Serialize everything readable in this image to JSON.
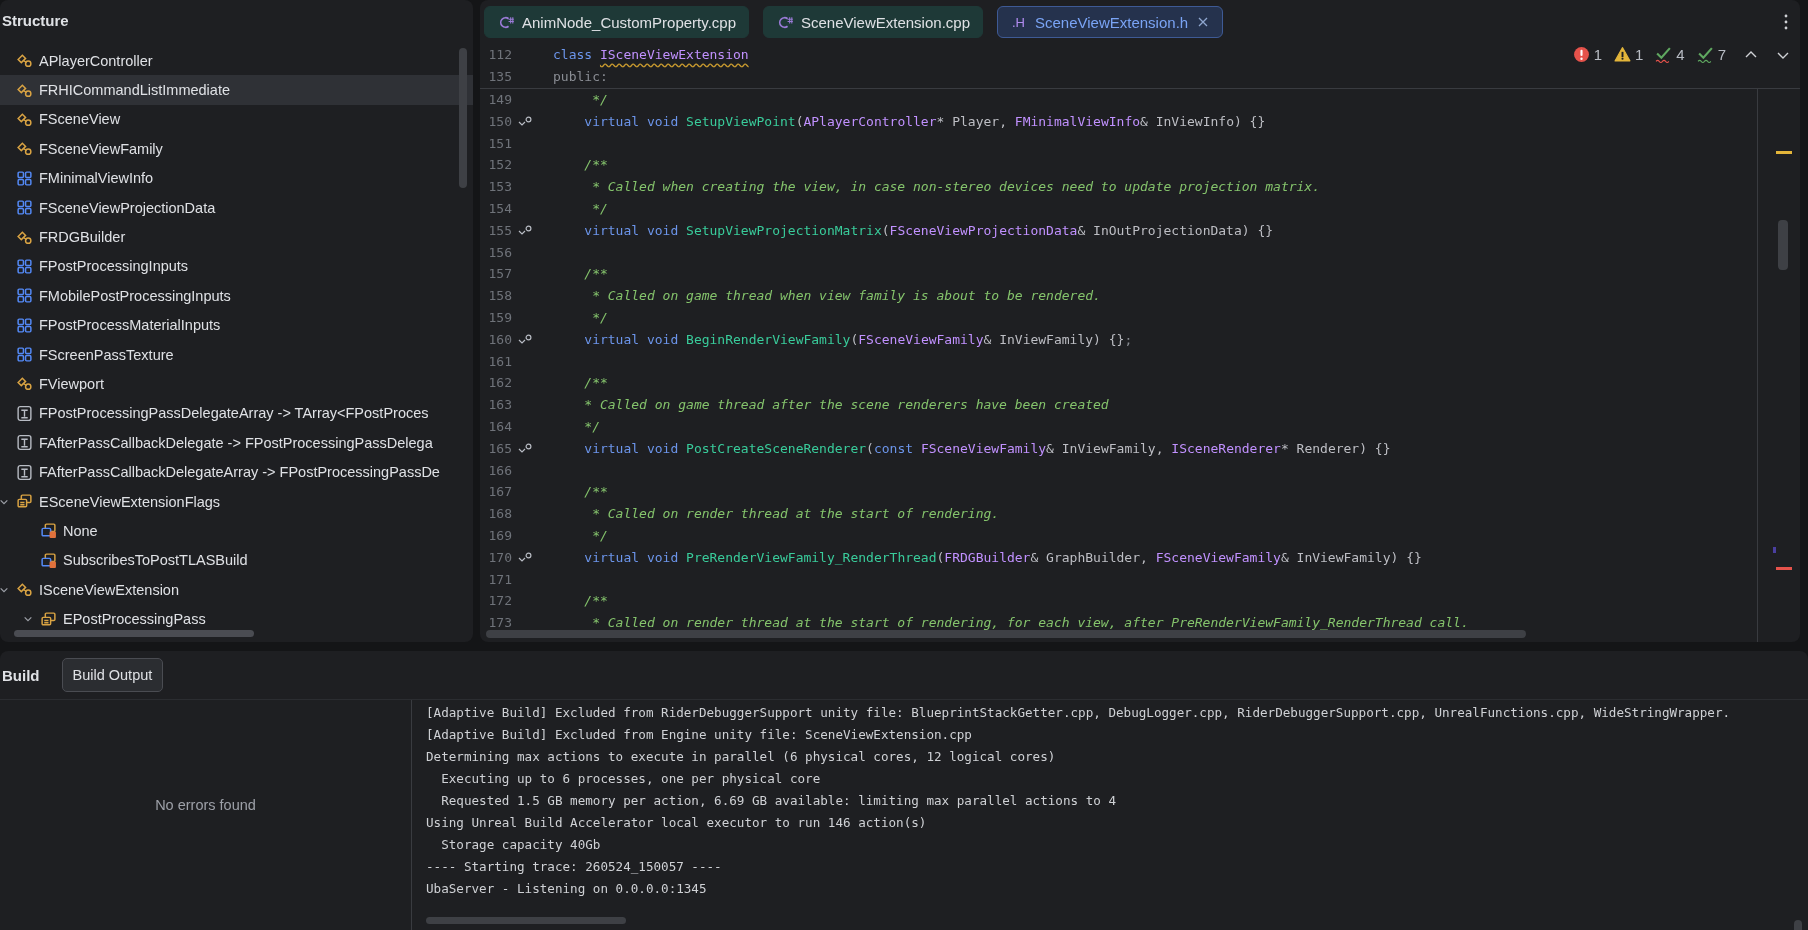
{
  "structure": {
    "title": "Structure",
    "items": [
      {
        "label": "APlayerController",
        "kind": "class",
        "selected": false
      },
      {
        "label": "FRHICommandListImmediate",
        "kind": "class",
        "selected": true
      },
      {
        "label": "FSceneView",
        "kind": "class",
        "selected": false
      },
      {
        "label": "FSceneViewFamily",
        "kind": "class",
        "selected": false
      },
      {
        "label": "FMinimalViewInfo",
        "kind": "struct",
        "selected": false
      },
      {
        "label": "FSceneViewProjectionData",
        "kind": "struct",
        "selected": false
      },
      {
        "label": "FRDGBuilder",
        "kind": "class",
        "selected": false
      },
      {
        "label": "FPostProcessingInputs",
        "kind": "struct",
        "selected": false
      },
      {
        "label": "FMobilePostProcessingInputs",
        "kind": "struct",
        "selected": false
      },
      {
        "label": "FPostProcessMaterialInputs",
        "kind": "struct",
        "selected": false
      },
      {
        "label": "FScreenPassTexture",
        "kind": "struct",
        "selected": false
      },
      {
        "label": "FViewport",
        "kind": "class",
        "selected": false
      },
      {
        "label": "FPostProcessingPassDelegateArray -> TArray<FPostProces",
        "kind": "typedef",
        "selected": false
      },
      {
        "label": "FAfterPassCallbackDelegate -> FPostProcessingPassDelega",
        "kind": "typedef",
        "selected": false
      },
      {
        "label": "FAfterPassCallbackDelegateArray -> FPostProcessingPassDe",
        "kind": "typedef",
        "selected": false
      },
      {
        "label": "ESceneViewExtensionFlags",
        "kind": "enum",
        "selected": false,
        "expanded": true,
        "children": [
          {
            "label": "None",
            "kind": "enum_member",
            "selected": false
          },
          {
            "label": "SubscribesToPostTLASBuild",
            "kind": "enum_member",
            "selected": false
          }
        ]
      },
      {
        "label": "ISceneViewExtension",
        "kind": "class",
        "selected": false,
        "expanded": true,
        "children": [
          {
            "label": "EPostProcessingPass",
            "kind": "enum",
            "selected": false,
            "expanded": true
          }
        ]
      }
    ]
  },
  "editor": {
    "tabs": [
      {
        "label": "AnimNode_CustomProperty.cpp",
        "kind": "cpp",
        "selected": false
      },
      {
        "label": "SceneViewExtension.cpp",
        "kind": "cpp",
        "selected": false
      },
      {
        "label": "SceneViewExtension.h",
        "kind": "h",
        "badge": ".H",
        "selected": true
      }
    ],
    "inspections": [
      {
        "kind": "error",
        "count": "1"
      },
      {
        "kind": "warning",
        "count": "1"
      },
      {
        "kind": "weak",
        "count": "4"
      },
      {
        "kind": "typo",
        "count": "7"
      }
    ],
    "sticky_lines": [
      {
        "number": "112",
        "tokens": [
          {
            "text": "class ",
            "kind": "kw"
          },
          {
            "text": "ISceneViewExtension",
            "kind": "type_warn"
          }
        ]
      },
      {
        "number": "135",
        "tokens": [
          {
            "text": "public:",
            "kind": "dim"
          }
        ]
      }
    ],
    "lines": [
      {
        "number": "149",
        "marker": false,
        "tokens": [
          {
            "text": "     */",
            "kind": "comment"
          }
        ]
      },
      {
        "number": "150",
        "marker": true,
        "tokens": [
          {
            "text": "    virtual void ",
            "kind": "kw"
          },
          {
            "text": "SetupViewPoint",
            "kind": "fn"
          },
          {
            "text": "(",
            "kind": "plain"
          },
          {
            "text": "APlayerController",
            "kind": "type"
          },
          {
            "text": "* Player, ",
            "kind": "plain"
          },
          {
            "text": "FMinimalViewInfo",
            "kind": "type"
          },
          {
            "text": "& InViewInfo) {}",
            "kind": "plain"
          }
        ]
      },
      {
        "number": "151",
        "marker": false
      },
      {
        "number": "152",
        "marker": false,
        "tokens": [
          {
            "text": "    /**",
            "kind": "comment"
          }
        ]
      },
      {
        "number": "153",
        "marker": false,
        "tokens": [
          {
            "text": "     * Called when creating the view, in case non-stereo devices need to update projection matrix.",
            "kind": "comment"
          }
        ]
      },
      {
        "number": "154",
        "marker": false,
        "tokens": [
          {
            "text": "     */",
            "kind": "comment"
          }
        ]
      },
      {
        "number": "155",
        "marker": true,
        "tokens": [
          {
            "text": "    virtual void ",
            "kind": "kw"
          },
          {
            "text": "SetupViewProjectionMatrix",
            "kind": "fn"
          },
          {
            "text": "(",
            "kind": "plain"
          },
          {
            "text": "FSceneViewProjectionData",
            "kind": "type"
          },
          {
            "text": "& InOutProjectionData) {}",
            "kind": "plain"
          }
        ]
      },
      {
        "number": "156",
        "marker": false
      },
      {
        "number": "157",
        "marker": false,
        "tokens": [
          {
            "text": "    /**",
            "kind": "comment"
          }
        ]
      },
      {
        "number": "158",
        "marker": false,
        "tokens": [
          {
            "text": "     * Called on game thread when view family is about to be rendered.",
            "kind": "comment"
          }
        ]
      },
      {
        "number": "159",
        "marker": false,
        "tokens": [
          {
            "text": "     */",
            "kind": "comment"
          }
        ]
      },
      {
        "number": "160",
        "marker": true,
        "tokens": [
          {
            "text": "    virtual void ",
            "kind": "kw"
          },
          {
            "text": "BeginRenderViewFamily",
            "kind": "fn"
          },
          {
            "text": "(",
            "kind": "plain"
          },
          {
            "text": "FSceneViewFamily",
            "kind": "type"
          },
          {
            "text": "& InViewFamily) {}",
            "kind": "plain"
          },
          {
            "text": ";",
            "kind": "dim"
          }
        ]
      },
      {
        "number": "161",
        "marker": false
      },
      {
        "number": "162",
        "marker": false,
        "tokens": [
          {
            "text": "    /**",
            "kind": "comment"
          }
        ]
      },
      {
        "number": "163",
        "marker": false,
        "tokens": [
          {
            "text": "    * Called on game thread after the scene renderers have been created",
            "kind": "comment"
          }
        ]
      },
      {
        "number": "164",
        "marker": false,
        "tokens": [
          {
            "text": "    */",
            "kind": "comment"
          }
        ]
      },
      {
        "number": "165",
        "marker": true,
        "tokens": [
          {
            "text": "    virtual void ",
            "kind": "kw"
          },
          {
            "text": "PostCreateSceneRenderer",
            "kind": "fn"
          },
          {
            "text": "(",
            "kind": "plain"
          },
          {
            "text": "const ",
            "kind": "kw"
          },
          {
            "text": "FSceneViewFamily",
            "kind": "type"
          },
          {
            "text": "& InViewFamily, ",
            "kind": "plain"
          },
          {
            "text": "ISceneRenderer",
            "kind": "type"
          },
          {
            "text": "* Renderer) {}",
            "kind": "plain"
          }
        ]
      },
      {
        "number": "166",
        "marker": false
      },
      {
        "number": "167",
        "marker": false,
        "tokens": [
          {
            "text": "    /**",
            "kind": "comment"
          }
        ]
      },
      {
        "number": "168",
        "marker": false,
        "tokens": [
          {
            "text": "     * Called on render thread at the start of rendering.",
            "kind": "comment"
          }
        ]
      },
      {
        "number": "169",
        "marker": false,
        "tokens": [
          {
            "text": "     */",
            "kind": "comment"
          }
        ]
      },
      {
        "number": "170",
        "marker": true,
        "tokens": [
          {
            "text": "    virtual void ",
            "kind": "kw"
          },
          {
            "text": "PreRenderViewFamily_RenderThread",
            "kind": "fn"
          },
          {
            "text": "(",
            "kind": "plain"
          },
          {
            "text": "FRDGBuilder",
            "kind": "type"
          },
          {
            "text": "& GraphBuilder, ",
            "kind": "plain"
          },
          {
            "text": "FSceneViewFamily",
            "kind": "type"
          },
          {
            "text": "& InViewFamily) {}",
            "kind": "plain"
          }
        ]
      },
      {
        "number": "171",
        "marker": false
      },
      {
        "number": "172",
        "marker": false,
        "tokens": [
          {
            "text": "    /**",
            "kind": "comment"
          }
        ]
      },
      {
        "number": "173",
        "marker": false,
        "tokens": [
          {
            "text": "     * Called on render thread at the start of rendering, for each view, after PreRenderViewFamily_RenderThread call.",
            "kind": "comment"
          }
        ]
      }
    ]
  },
  "build": {
    "title": "Build",
    "tabs": [
      {
        "label": "Build Output",
        "selected": true
      }
    ],
    "status": "No errors found",
    "log": [
      "[Adaptive Build] Excluded from RiderDebuggerSupport unity file: BlueprintStackGetter.cpp, DebugLogger.cpp, RiderDebuggerSupport.cpp, UnrealFunctions.cpp, WideStringWrapper.",
      "[Adaptive Build] Excluded from Engine unity file: SceneViewExtension.cpp",
      "Determining max actions to execute in parallel (6 physical cores, 12 logical cores)",
      "  Executing up to 6 processes, one per physical core",
      "  Requested 1.5 GB memory per action, 6.69 GB available: limiting max parallel actions to 4",
      "Using Unreal Build Accelerator local executor to run 146 action(s)",
      "  Storage capacity 40Gb",
      "---- Starting trace: 260524_150057 ----",
      "UbaServer - Listening on 0.0.0.0:1345"
    ]
  }
}
